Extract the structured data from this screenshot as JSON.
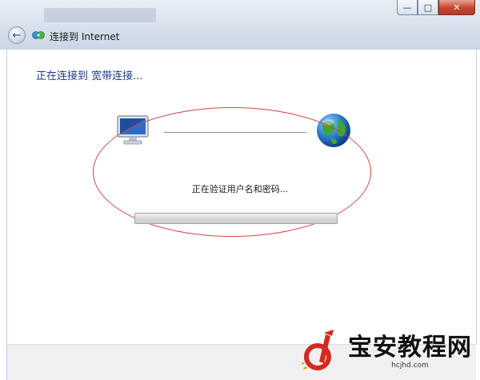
{
  "window": {
    "title": "连接到 Internet",
    "minimize_glyph": "—",
    "maximize_glyph": "□",
    "close_glyph": "✕",
    "back_glyph": "←"
  },
  "content": {
    "heading": "正在连接到 宽带连接...",
    "status": "正在验证用户名和密码...",
    "progress": 0
  },
  "watermark": {
    "name": "宝安教程网",
    "url": "hcjhd.com"
  },
  "colors": {
    "heading": "#1e3a8a",
    "annotation": "#d94040",
    "brand_red": "#d42a1e"
  }
}
